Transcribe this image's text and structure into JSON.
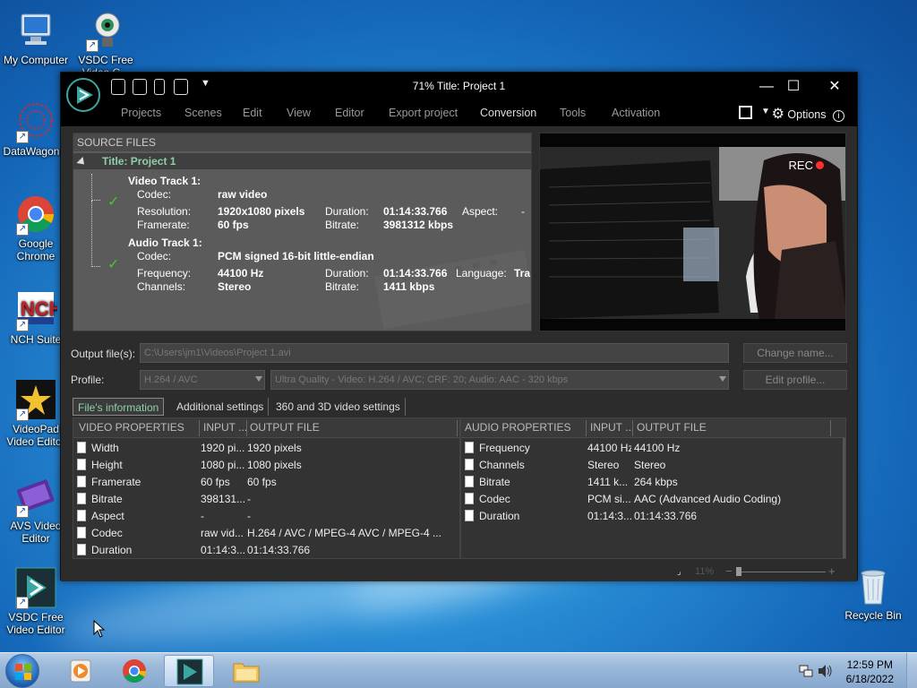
{
  "desktop": {
    "icons": [
      {
        "label": "My Computer"
      },
      {
        "label": "VSDC Free Video C..."
      },
      {
        "label": "DataWagon..."
      },
      {
        "label": "Google Chrome"
      },
      {
        "label": "NCH Suite"
      },
      {
        "label": "VideoPad Video Editor"
      },
      {
        "label": "AVS Video Editor"
      },
      {
        "label": "VSDC Free Video Editor"
      },
      {
        "label": "Recycle Bin"
      }
    ]
  },
  "window": {
    "title": "71% Title: Project 1",
    "controls": {
      "minimize": "—",
      "maximize": "☐",
      "close": "✕"
    },
    "menu": [
      "Projects",
      "Scenes",
      "Edit",
      "View",
      "Editor",
      "Export project",
      "Conversion",
      "Tools",
      "Activation"
    ],
    "active_menu": "Conversion",
    "options_label": "Options"
  },
  "source": {
    "header": "SOURCE FILES",
    "project_title": "Title: Project 1",
    "video_track": {
      "title": "Video Track 1:",
      "codec_label": "Codec:",
      "codec": "raw video",
      "resolution_label": "Resolution:",
      "resolution": "1920x1080 pixels",
      "duration_label": "Duration:",
      "duration": "01:14:33.766",
      "aspect_label": "Aspect:",
      "aspect": "-",
      "framerate_label": "Framerate:",
      "framerate": "60 fps",
      "bitrate_label": "Bitrate:",
      "bitrate": "3981312 kbps"
    },
    "audio_track": {
      "title": "Audio Track 1:",
      "codec_label": "Codec:",
      "codec": "PCM signed 16-bit little-endian",
      "frequency_label": "Frequency:",
      "frequency": "44100 Hz",
      "duration_label": "Duration:",
      "duration": "01:14:33.766",
      "language_label": "Language:",
      "language": "Tra",
      "channels_label": "Channels:",
      "channels": "Stereo",
      "bitrate_label": "Bitrate:",
      "bitrate": "1411 kbps"
    }
  },
  "preview": {
    "rec_label": "REC"
  },
  "output": {
    "file_label": "Output file(s):",
    "file_value": "C:\\Users\\jm1\\Videos\\Project 1.avi",
    "change_name": "Change name...",
    "profile_label": "Profile:",
    "profile_codec": "H.264 / AVC",
    "profile_preset": "Ultra Quality - Video: H.264 / AVC; CRF: 20; Audio: AAC - 320 kbps",
    "edit_profile": "Edit profile..."
  },
  "tabs": [
    "File's information",
    "Additional settings",
    "360 and 3D video settings"
  ],
  "video_table": {
    "headers": [
      "VIDEO PROPERTIES",
      "INPUT ...",
      "OUTPUT FILE"
    ],
    "rows": [
      [
        "Width",
        "1920 pi...",
        "1920 pixels"
      ],
      [
        "Height",
        "1080 pi...",
        "1080 pixels"
      ],
      [
        "Framerate",
        "60 fps",
        "60 fps"
      ],
      [
        "Bitrate",
        "398131...",
        "-"
      ],
      [
        "Aspect",
        "-",
        "-"
      ],
      [
        "Codec",
        "raw vid...",
        "H.264 / AVC / MPEG-4 AVC / MPEG-4 ..."
      ],
      [
        "Duration",
        "01:14:3...",
        "01:14:33.766"
      ]
    ]
  },
  "audio_table": {
    "headers": [
      "AUDIO PROPERTIES",
      "INPUT ...",
      "OUTPUT FILE"
    ],
    "rows": [
      [
        "Frequency",
        "44100 Hz",
        "44100 Hz"
      ],
      [
        "Channels",
        "Stereo",
        "Stereo"
      ],
      [
        "Bitrate",
        "1411 k...",
        "264 kbps"
      ],
      [
        "Codec",
        "PCM si...",
        "AAC (Advanced Audio Coding)"
      ],
      [
        "Duration",
        "01:14:3...",
        "01:14:33.766"
      ]
    ]
  },
  "statusbar": {
    "zoom": "11%"
  },
  "taskbar": {
    "time": "12:59 PM",
    "date": "6/18/2022"
  }
}
